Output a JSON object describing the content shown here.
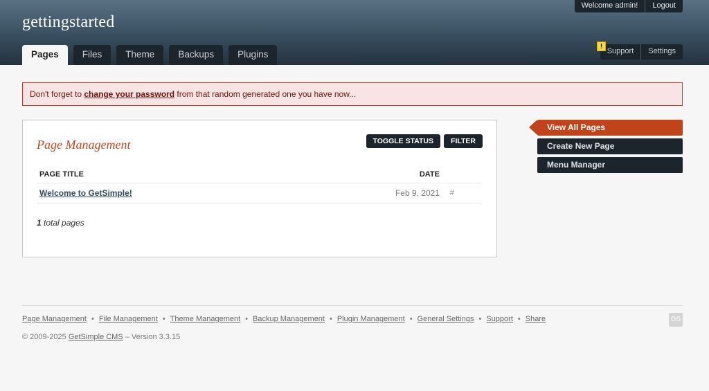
{
  "header": {
    "site_title": "gettingstarted",
    "welcome": "Welcome admin!",
    "logout": "Logout",
    "tabs": [
      {
        "label": "Pages",
        "current": true
      },
      {
        "label": "Files"
      },
      {
        "label": "Theme"
      },
      {
        "label": "Backups"
      },
      {
        "label": "Plugins"
      }
    ],
    "alert_glyph": "!",
    "support": "Support",
    "settings": "Settings"
  },
  "notice": {
    "prefix": "Don't forget to ",
    "link": "change your password",
    "suffix": " from that random generated one you have now..."
  },
  "main": {
    "title": "Page Management",
    "toggle_status": "TOGGLE STATUS",
    "filter": "FILTER",
    "columns": {
      "title": "PAGE TITLE",
      "date": "DATE"
    },
    "rows": [
      {
        "title": "Welcome to GetSimple!",
        "date": "Feb 9, 2021",
        "link": "#"
      }
    ],
    "total_count": "1",
    "total_label": " total pages"
  },
  "sidebar": {
    "items": [
      {
        "label": "View All Pages",
        "current": true
      },
      {
        "label": "Create New Page"
      },
      {
        "label": "Menu Manager"
      }
    ]
  },
  "footer": {
    "links": [
      "Page Management",
      "File Management",
      "Theme Management",
      "Backup Management",
      "Plugin Management",
      "General Settings",
      "Support",
      "Share"
    ],
    "separator": "•",
    "copyright_prefix": "© 2009-2025 ",
    "copyright_link": "GetSimple CMS",
    "copyright_suffix": " – Version 3.3.15",
    "logo_text": "GS"
  },
  "colors": {
    "accent": "#c0431b",
    "dark": "#1c252c",
    "notice_border": "#c4372d"
  }
}
